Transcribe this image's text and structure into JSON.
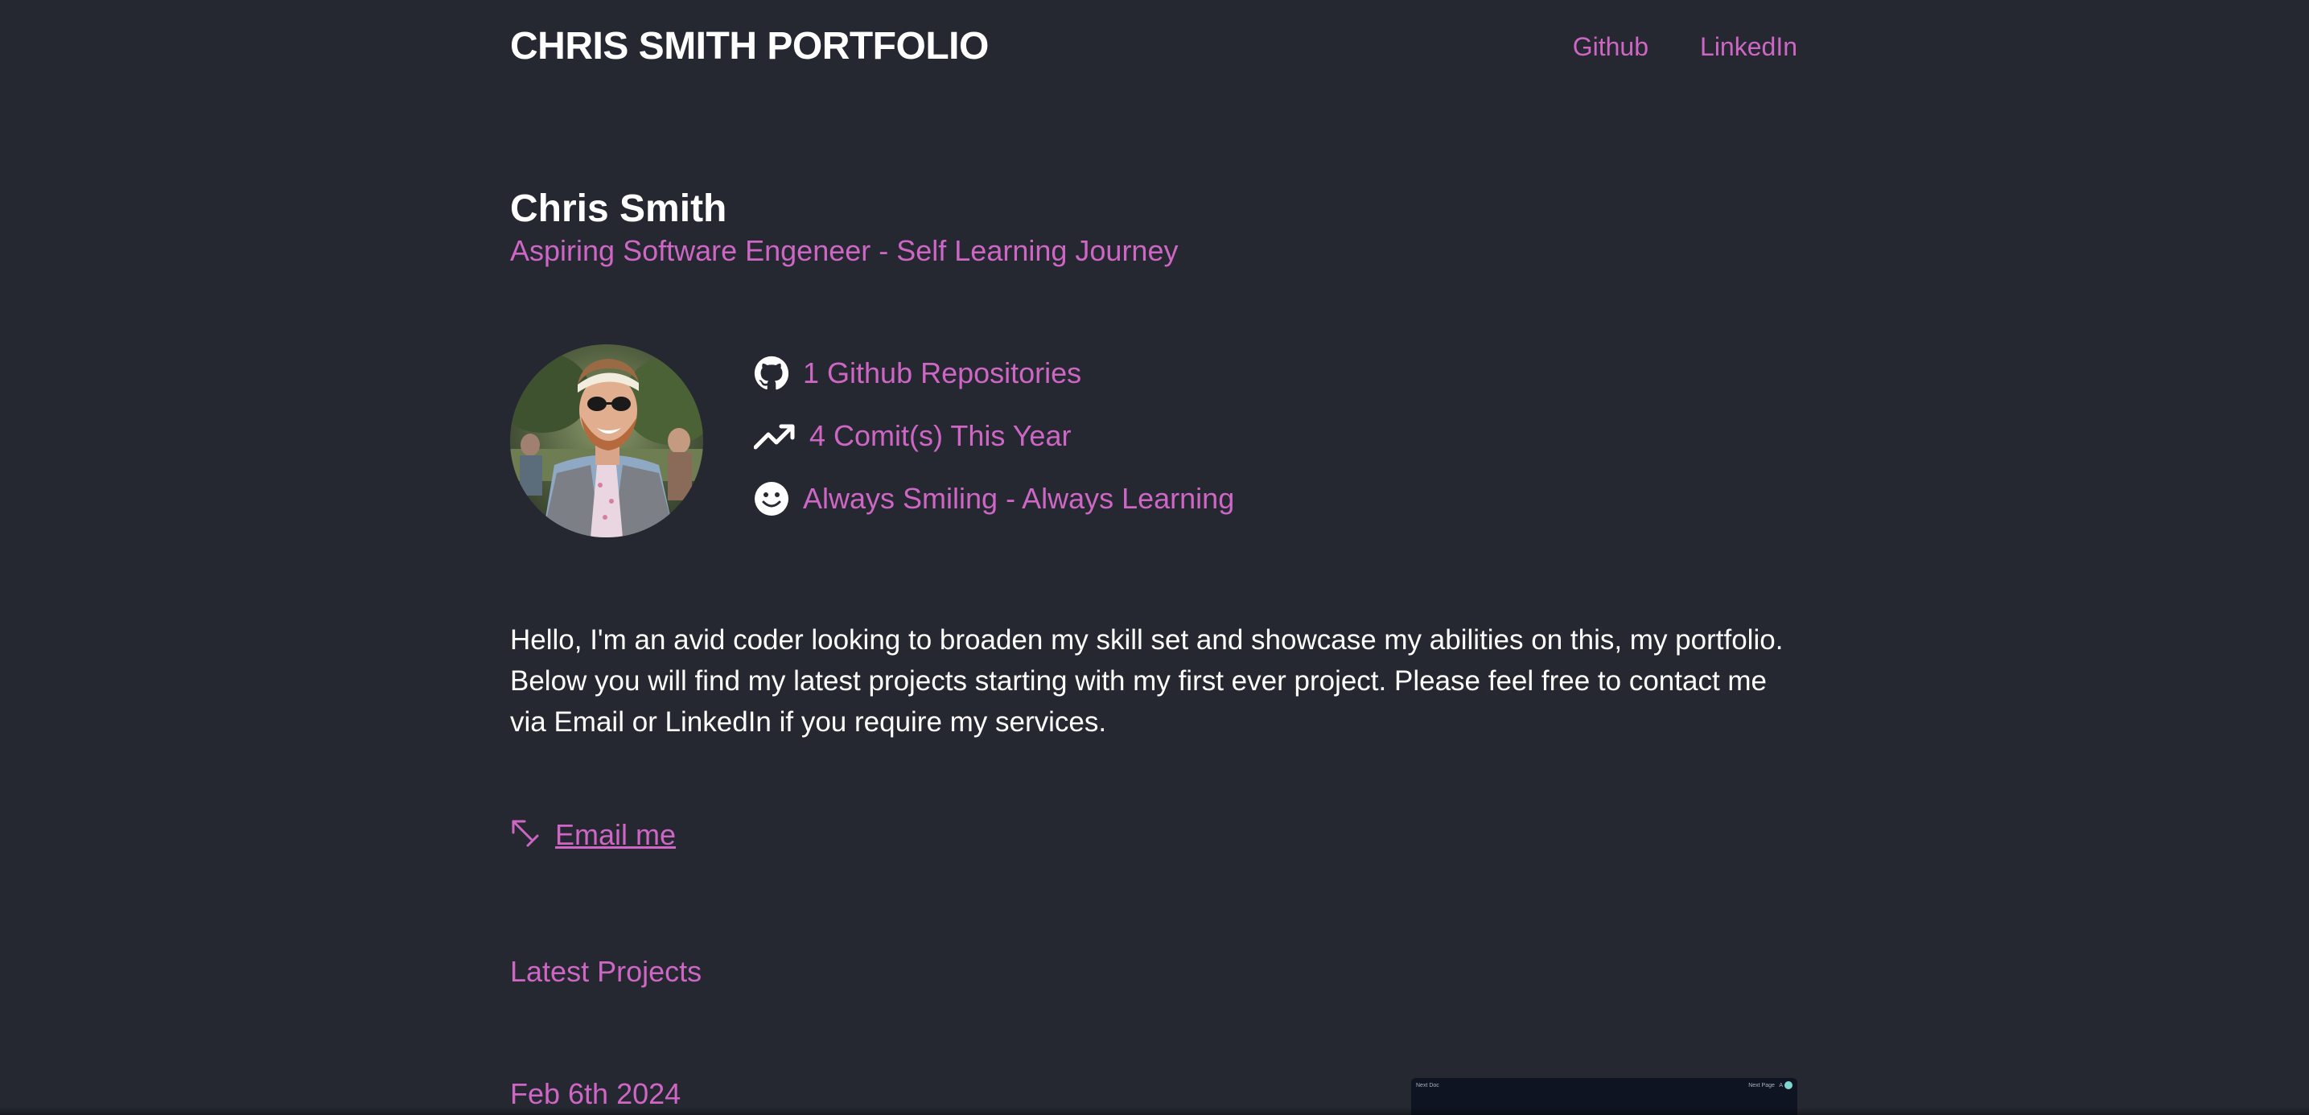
{
  "header": {
    "brand": "CHRIS SMITH PORTFOLIO",
    "nav": [
      {
        "label": "Github"
      },
      {
        "label": "LinkedIn"
      }
    ]
  },
  "intro": {
    "name": "Chris Smith",
    "subtitle": "Aspiring Software Engeneer - Self Learning Journey"
  },
  "stats": [
    {
      "icon": "github-icon",
      "label": "1 Github Repositories"
    },
    {
      "icon": "trending-up-icon",
      "label": "4 Comit(s) This Year"
    },
    {
      "icon": "smile-icon",
      "label": "Always Smiling - Always Learning"
    }
  ],
  "bio": "Hello, I'm an avid coder looking to broaden my skill set and showcase my abilities on this, my portfolio. Below you will find my latest projects starting with my first ever project. Please feel free to contact me via Email or LinkedIn if you require my services.",
  "email": {
    "label": "Email me",
    "icon": "arrow-up-right-icon"
  },
  "projects": {
    "section_title": "Latest Projects",
    "items": [
      {
        "date": "Feb 6th 2024",
        "thumbnail": {
          "nav_left": "Next Doc",
          "nav_right": "Next Page   A"
        }
      }
    ]
  },
  "colors": {
    "background": "#252830",
    "accent": "#cd66c4",
    "text": "#ffffff"
  }
}
